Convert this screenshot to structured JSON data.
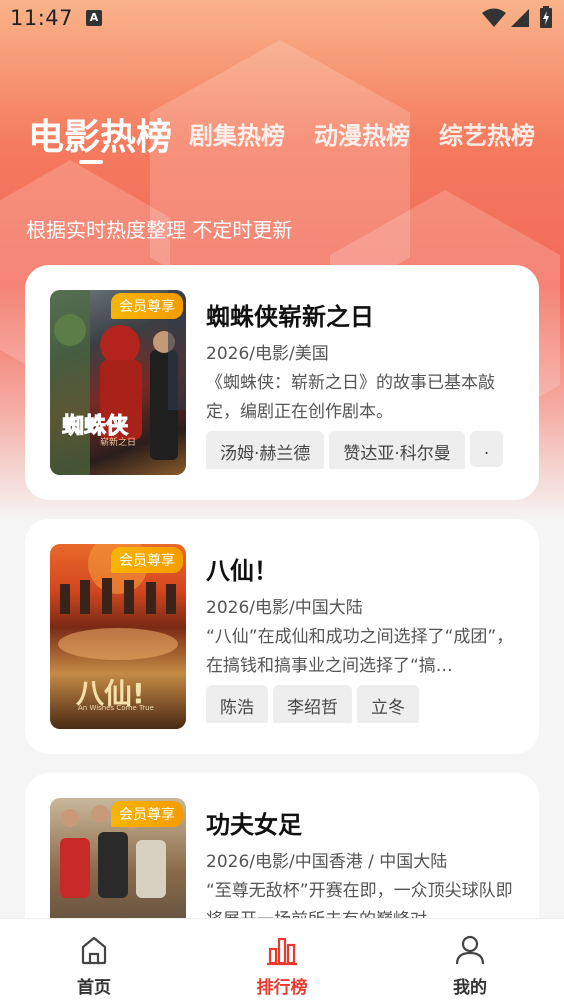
{
  "status_bar": {
    "time": "11:47",
    "notification_icon_letter": "A"
  },
  "tabs": [
    {
      "label": "电影热榜",
      "active": true
    },
    {
      "label": "剧集热榜",
      "active": false
    },
    {
      "label": "动漫热榜",
      "active": false
    },
    {
      "label": "综艺热榜",
      "active": false
    }
  ],
  "subtitle": "根据实时热度整理 不定时更新",
  "cards": [
    {
      "badge": "会员尊享",
      "title": "蜘蛛侠崭新之日",
      "meta": "2026/电影/美国",
      "desc": "《蜘蛛侠：崭新之日》的故事已基本敲定，编剧正在创作剧本。",
      "tags": [
        "汤姆·赫兰德",
        "赞达亚·科尔曼",
        "."
      ],
      "poster_text": "蜘蛛侠",
      "poster_subtext": "崭新之日"
    },
    {
      "badge": "会员尊享",
      "title": "八仙！",
      "meta": "2026/电影/中国大陆",
      "desc": "“八仙”在成仙和成功之间选择了“成团”，在搞钱和搞事业之间选择了“搞…",
      "tags": [
        "陈浩",
        "李绍哲",
        "立冬"
      ],
      "poster_text": "八仙!",
      "poster_subtext": "An Wishes Come True"
    },
    {
      "badge": "会员尊享",
      "title": "功夫女足",
      "meta": "2026/电影/中国香港 / 中国大陆",
      "desc": "“至尊无敌杯”开赛在即，一众顶尖球队即将展开一场前所未有的巅峰对",
      "tags": [],
      "poster_text": "",
      "poster_subtext": ""
    }
  ],
  "bottom_nav": [
    {
      "label": "首页",
      "icon": "home-icon",
      "active": false
    },
    {
      "label": "排行榜",
      "icon": "chart-icon",
      "active": true
    },
    {
      "label": "我的",
      "icon": "user-icon",
      "active": false
    }
  ],
  "colors": {
    "accent": "#e83a2e",
    "badge": "#f7b500"
  }
}
